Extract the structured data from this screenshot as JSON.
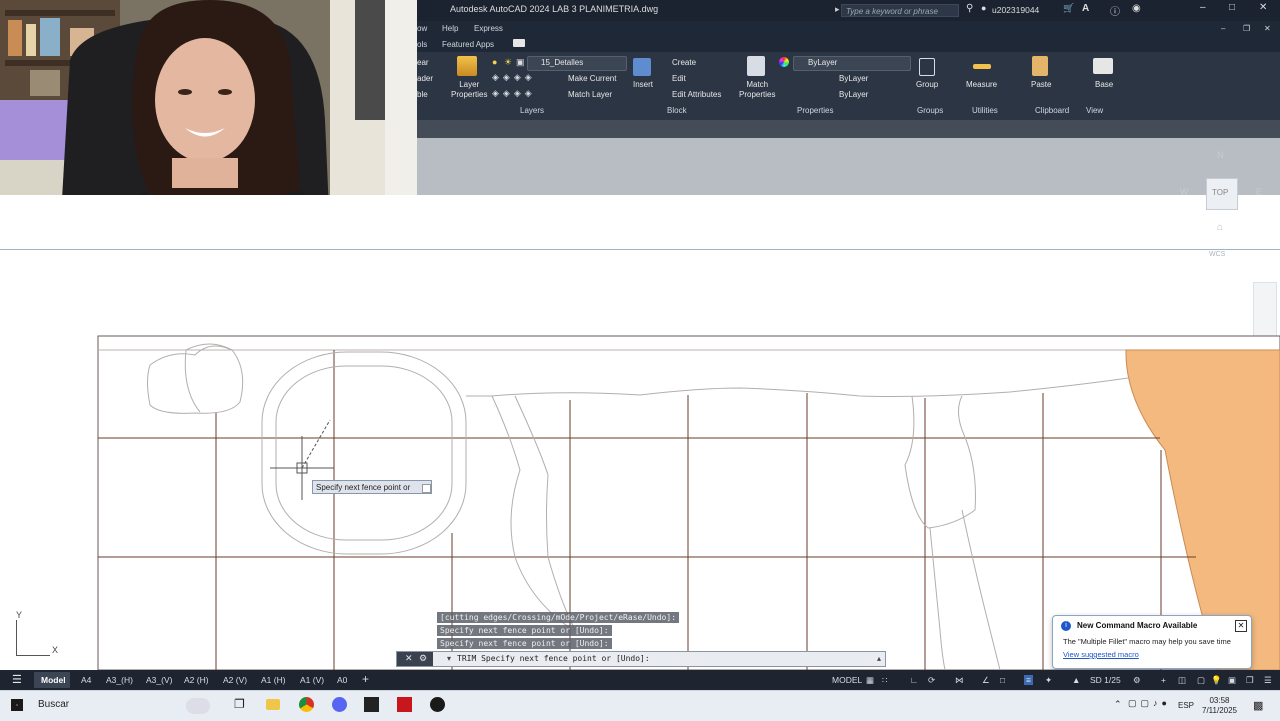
{
  "titlebar": {
    "title": "Autodesk AutoCAD 2024   LAB 3 PLANIMETRIA.dwg",
    "search_placeholder": "Type a keyword or phrase",
    "user": "u202319044"
  },
  "menubar": {
    "items": [
      "ow",
      "Help",
      "Express"
    ]
  },
  "tabsrow": {
    "items": [
      "ols",
      "Featured Apps"
    ]
  },
  "ribbon": {
    "left_cut": [
      "ear",
      "ader",
      "ble"
    ],
    "layer_properties": "Layer\nProperties",
    "layer_current": "15_Detalles",
    "make_current": "Make Current",
    "match_layer": "Match Layer",
    "insert": "Insert",
    "create": "Create",
    "edit": "Edit",
    "edit_attributes": "Edit Attributes",
    "match_properties": "Match\nProperties",
    "color": "ByLayer",
    "linetype": "ByLayer",
    "lineweight": "ByLayer",
    "group": "Group",
    "measure": "Measure",
    "paste": "Paste",
    "base": "Base",
    "panels": [
      "Layers",
      "Block",
      "Properties",
      "Groups",
      "Utilities",
      "Clipboard",
      "View"
    ]
  },
  "viewcube": {
    "north": "N",
    "west": "W",
    "east": "E",
    "face": "TOP",
    "wcs": "WCS"
  },
  "tooltip": {
    "text": "Specify next fence point or"
  },
  "history": [
    "[cutting edges/Crossing/mOde/Project/eRase/Undo]:",
    "Specify next fence point or [Undo]:",
    "Specify next fence point or [Undo]:"
  ],
  "command_line": {
    "text": "TRIM Specify next fence point or [Undo]:"
  },
  "ucs": {
    "x": "X",
    "y": "Y"
  },
  "notification": {
    "title": "New Command Macro Available",
    "body": "The \"Multiple Fillet\" macro may help you save time",
    "link": "View suggested macro"
  },
  "layout_tabs": [
    "Model",
    "A4",
    "A3_(H)",
    "A3_(V)",
    "A2 (H)",
    "A2 (V)",
    "A1 (H)",
    "A1 (V)",
    "A0"
  ],
  "status": {
    "model": "MODEL",
    "scale": "SD 1/25"
  },
  "taskbar": {
    "search": "Buscar",
    "lang": "ESP",
    "time": "03:58",
    "date": "7/11/2025"
  },
  "colors": {
    "ribbon": "#2b3544",
    "accent_fill": "#f3b97f",
    "grid_line": "#6b3a2a"
  }
}
